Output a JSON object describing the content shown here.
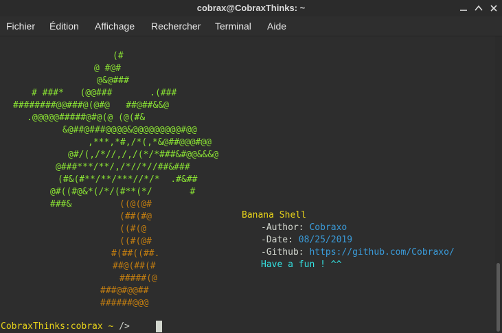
{
  "window": {
    "title": "cobrax@CobraxThinks: ~"
  },
  "menu": [
    "Fichier",
    "Édition",
    "Affichage",
    "Rechercher",
    "Terminal",
    "Aide"
  ],
  "logo_lines": [
    "(#",
    "@ #@#",
    "@&@###",
    "# ###*   (@@###       .(###",
    "########@@###@(@#@   ##@##&&@",
    ".@@@@@#####@#@(@ (@(#&",
    "&@##@###@@@@&@@@@@@@@@#@@",
    ",***,*#,/*(,*&@##@@@#@@",
    "@#/(,/*//,/,/(*/*###&#@@&&&@",
    "@###***/**/,/*//*//##&###",
    "(#&(#**/**/***//*/*  .#&##",
    "@#((#@&*(/*/(#**(*/       #",
    "###&"
  ],
  "trunk_lines": [
    "((@(@#",
    "(##(#@",
    "((#(@",
    "((#(@#",
    "#(##((##.",
    "##@(##(#",
    "#####(@",
    "###@#@@##",
    "######@@@"
  ],
  "info": {
    "name": "Banana Shell",
    "author_label": "-Author: ",
    "author_value": "Cobraxo",
    "date_label": "-Date: ",
    "date_value": "08/25/2019",
    "github_label": "-Github: ",
    "github_value": "https://github.com/Cobraxo/",
    "tagline": "Have a fun ! ^^"
  },
  "prompt": {
    "host": "CobraxThinks:cobrax ~",
    "symbol": " />"
  },
  "colors": {
    "green": "#8ae234",
    "orange": "#c17d11",
    "yellow": "#e9d41a",
    "blue": "#3a9bd9",
    "cyan": "#34e2e2",
    "background": "#2d2d2d"
  }
}
